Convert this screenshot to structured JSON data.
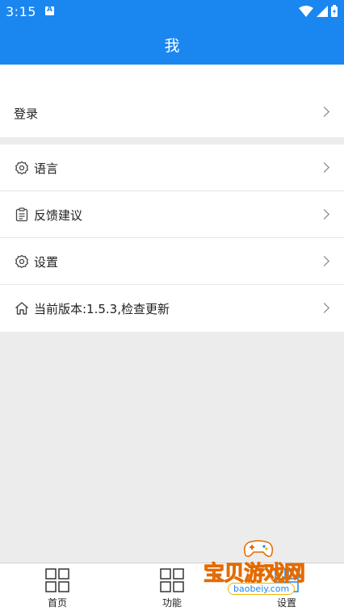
{
  "status_bar": {
    "time": "3:15"
  },
  "header": {
    "title": "我"
  },
  "login": {
    "label": "登录"
  },
  "menu": [
    {
      "label": "语言",
      "icon": "gear-icon"
    },
    {
      "label": "反馈建议",
      "icon": "clipboard-icon"
    },
    {
      "label": "设置",
      "icon": "gear-icon"
    },
    {
      "label": "当前版本:1.5.3,检查更新",
      "icon": "home-icon"
    }
  ],
  "bottom_nav": [
    {
      "label": "首页",
      "icon": "grid-icon"
    },
    {
      "label": "功能",
      "icon": "grid-icon"
    },
    {
      "label": "设置",
      "icon": "grid-icon"
    }
  ],
  "watermark": {
    "text": "宝贝游戏网",
    "url": "baobeiy.com"
  },
  "colors": {
    "primary": "#1a86f0",
    "background": "#ececec"
  }
}
